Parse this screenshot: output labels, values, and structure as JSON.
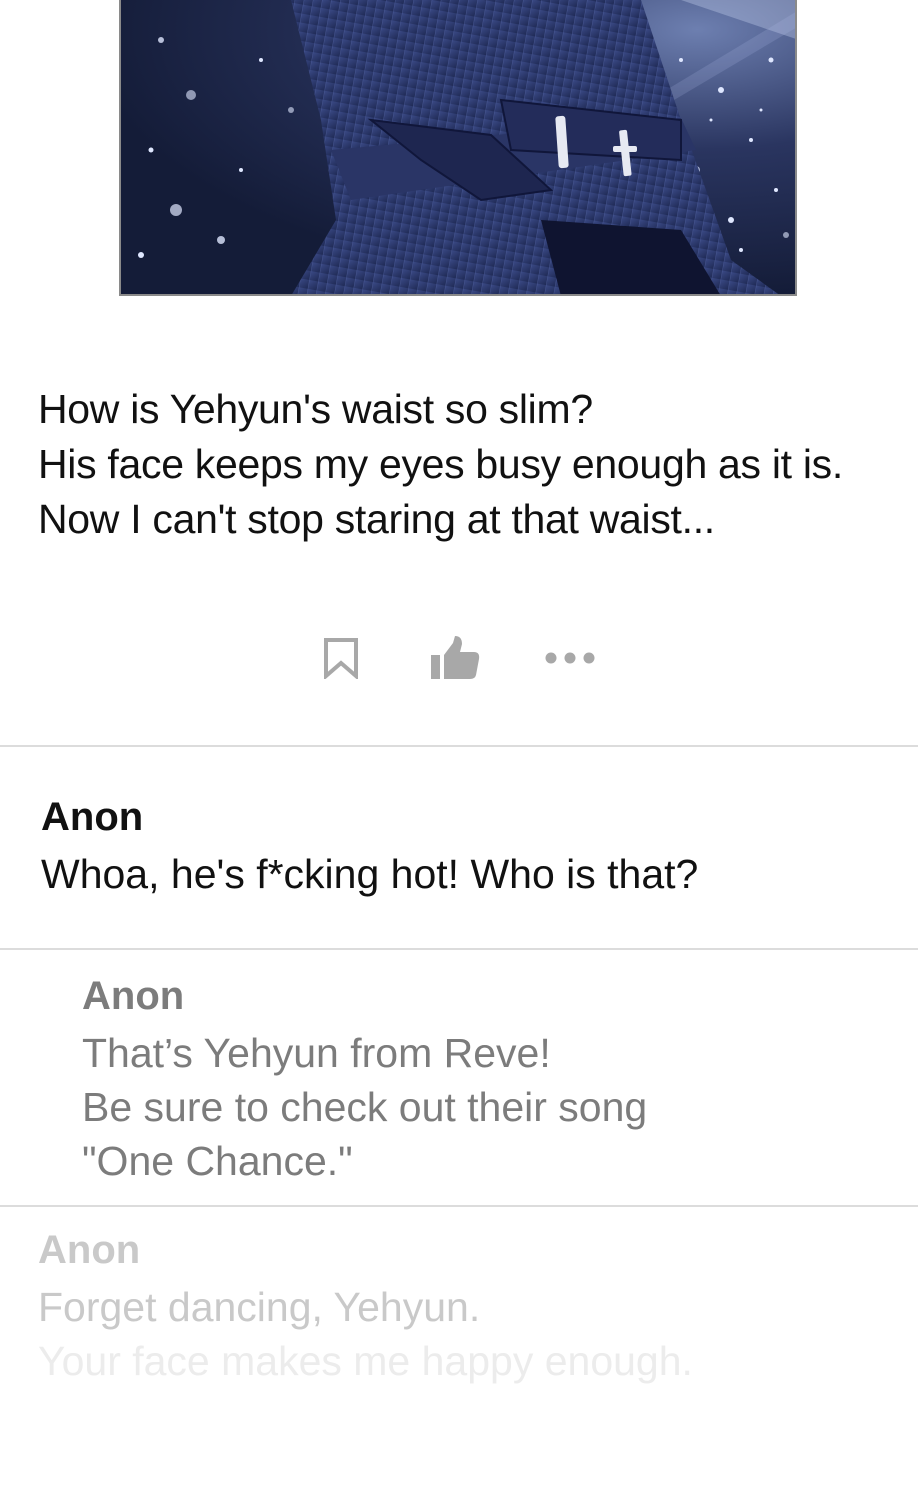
{
  "post": {
    "image_alt": "manga-panel",
    "caption_lines": [
      "How is Yehyun's waist so slim?",
      "His face keeps my eyes busy enough as it is.",
      "Now I can't stop staring at that waist..."
    ]
  },
  "actions": {
    "bookmark_icon": "bookmark-icon",
    "like_icon": "thumbs-up-icon",
    "more_icon": "more-dots-icon",
    "icon_color": "#a8a8a8"
  },
  "comments": [
    {
      "author": "Anon",
      "lines": [
        "Whoa, he's f*cking hot! Who is that?"
      ]
    },
    {
      "author": "Anon",
      "lines": [
        "That’s Yehyun from Reve!",
        "Be sure to check out their song",
        "\"One Chance.\""
      ]
    },
    {
      "author": "Anon",
      "lines": [
        "Forget dancing, Yehyun.",
        "Your face makes me happy enough."
      ]
    }
  ]
}
